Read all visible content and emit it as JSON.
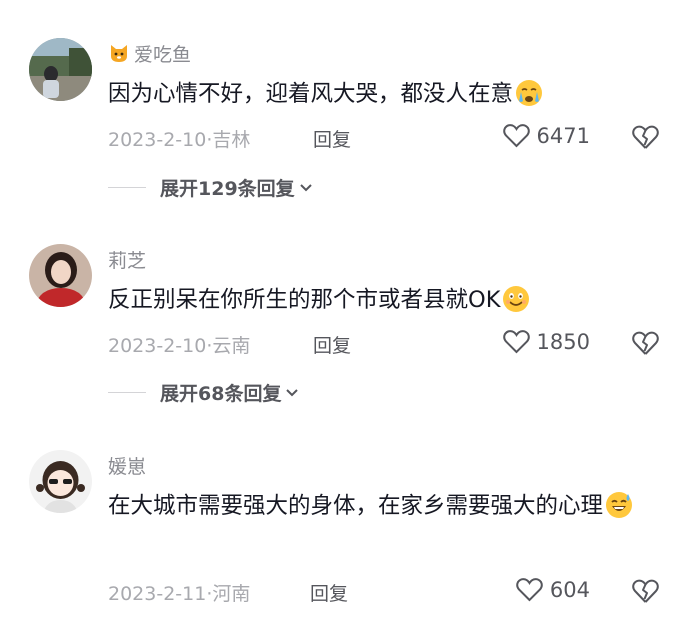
{
  "comments": [
    {
      "username": "爱吃鱼",
      "has_badge": true,
      "text": "因为心情不好，迎着风大哭，都没人在意",
      "emoji": "crying-face-icon",
      "date": "2023-2-10",
      "location": "吉林",
      "reply_label": "回复",
      "likes": "6471",
      "expand_label": "展开129条回复"
    },
    {
      "username": "莉芝",
      "text": "反正别呆在你所生的那个市或者县就OK",
      "emoji": "smiling-face-icon",
      "date": "2023-2-10",
      "location": "云南",
      "reply_label": "回复",
      "likes": "1850",
      "expand_label": "展开68条回复"
    },
    {
      "username": "媛崽",
      "text": "在大城市需要强大的身体，在家乡需要强大的心理",
      "emoji": "grinning-sweat-face-icon",
      "date": "2023-2-11",
      "location": "河南",
      "reply_label": "回复",
      "likes": "604"
    }
  ],
  "meta_separator": "·",
  "colors": {
    "text": "#161823",
    "secondary": "#8a8b91",
    "meta": "#a8a9ae",
    "emoji_yellow": "#ffc83d"
  }
}
